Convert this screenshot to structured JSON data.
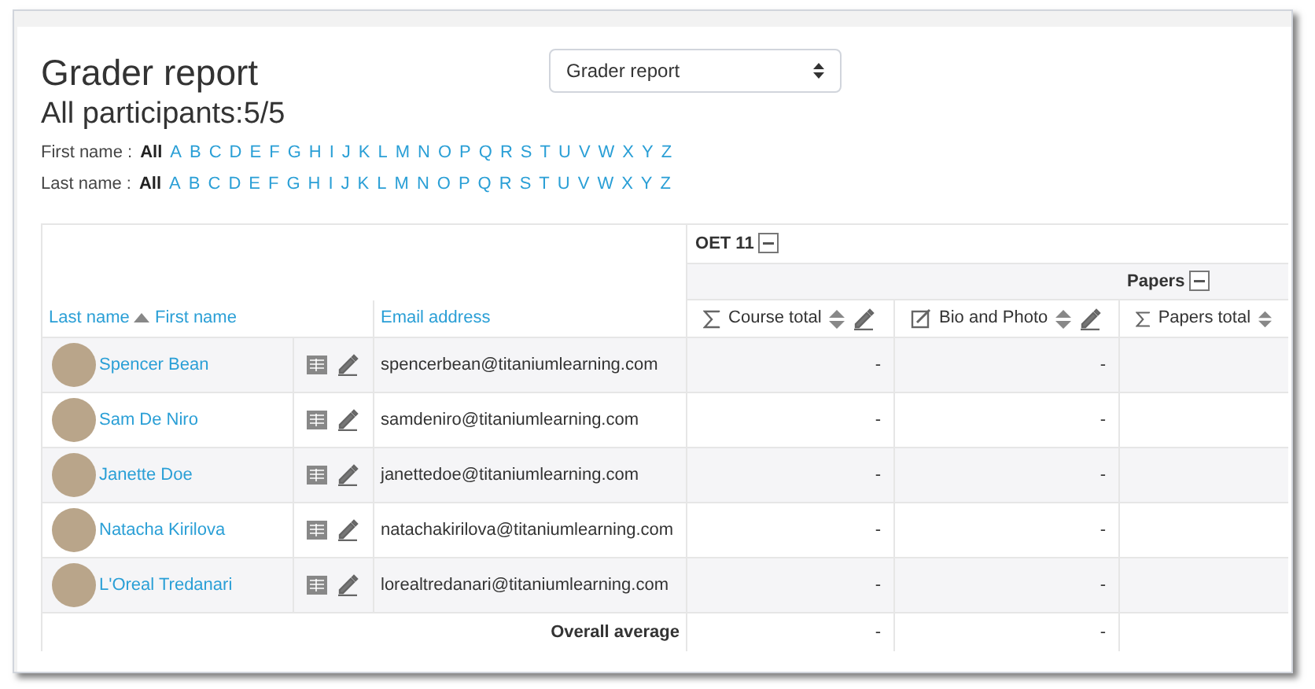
{
  "title": "Grader report",
  "subtitle": "All participants:5/5",
  "report_select": {
    "value": "Grader report"
  },
  "filters": [
    {
      "label": "First name :",
      "options": [
        {
          "text": "All",
          "selected": true
        },
        {
          "text": "A",
          "selected": false
        },
        {
          "text": "B",
          "selected": false
        },
        {
          "text": "C",
          "selected": false
        },
        {
          "text": "D",
          "selected": false
        },
        {
          "text": "E",
          "selected": false
        },
        {
          "text": "F",
          "selected": false
        },
        {
          "text": "G",
          "selected": false
        },
        {
          "text": "H",
          "selected": false
        },
        {
          "text": "I",
          "selected": false
        },
        {
          "text": "J",
          "selected": false
        },
        {
          "text": "K",
          "selected": false
        },
        {
          "text": "L",
          "selected": false
        },
        {
          "text": "M",
          "selected": false
        },
        {
          "text": "N",
          "selected": false
        },
        {
          "text": "O",
          "selected": false
        },
        {
          "text": "P",
          "selected": false
        },
        {
          "text": "Q",
          "selected": false
        },
        {
          "text": "R",
          "selected": false
        },
        {
          "text": "S",
          "selected": false
        },
        {
          "text": "T",
          "selected": false
        },
        {
          "text": "U",
          "selected": false
        },
        {
          "text": "V",
          "selected": false
        },
        {
          "text": "W",
          "selected": false
        },
        {
          "text": "X",
          "selected": false
        },
        {
          "text": "Y",
          "selected": false
        },
        {
          "text": "Z",
          "selected": false
        }
      ]
    },
    {
      "label": "Last name :",
      "options": [
        {
          "text": "All",
          "selected": true
        },
        {
          "text": "A",
          "selected": false
        },
        {
          "text": "B",
          "selected": false
        },
        {
          "text": "C",
          "selected": false
        },
        {
          "text": "D",
          "selected": false
        },
        {
          "text": "E",
          "selected": false
        },
        {
          "text": "F",
          "selected": false
        },
        {
          "text": "G",
          "selected": false
        },
        {
          "text": "H",
          "selected": false
        },
        {
          "text": "I",
          "selected": false
        },
        {
          "text": "J",
          "selected": false
        },
        {
          "text": "K",
          "selected": false
        },
        {
          "text": "L",
          "selected": false
        },
        {
          "text": "M",
          "selected": false
        },
        {
          "text": "N",
          "selected": false
        },
        {
          "text": "O",
          "selected": false
        },
        {
          "text": "P",
          "selected": false
        },
        {
          "text": "Q",
          "selected": false
        },
        {
          "text": "R",
          "selected": false
        },
        {
          "text": "S",
          "selected": false
        },
        {
          "text": "T",
          "selected": false
        },
        {
          "text": "U",
          "selected": false
        },
        {
          "text": "V",
          "selected": false
        },
        {
          "text": "W",
          "selected": false
        },
        {
          "text": "X",
          "selected": false
        },
        {
          "text": "Y",
          "selected": false
        },
        {
          "text": "Z",
          "selected": false
        }
      ]
    }
  ],
  "table": {
    "category": "OET 11",
    "subcategory": "Papers",
    "name_sort": [
      {
        "label": "Last name",
        "sorted": true
      },
      {
        "label": "First name",
        "sorted": false
      }
    ],
    "email_header": "Email address",
    "grade_columns": [
      {
        "label": "Course total",
        "kind": "total",
        "editable": true
      },
      {
        "label": "Bio and Photo",
        "kind": "assignment",
        "editable": true
      },
      {
        "label": "Papers total",
        "kind": "total",
        "editable": false
      }
    ],
    "rows": [
      {
        "name": "Spencer Bean",
        "email": "spencerbean@titaniumlearning.com",
        "grades": [
          "-",
          "-"
        ]
      },
      {
        "name": "Sam De Niro",
        "email": "samdeniro@titaniumlearning.com",
        "grades": [
          "-",
          "-"
        ]
      },
      {
        "name": "Janette Doe",
        "email": "janettedoe@titaniumlearning.com",
        "grades": [
          "-",
          "-"
        ]
      },
      {
        "name": "Natacha Kirilova",
        "email": "natachakirilova@titaniumlearning.com",
        "grades": [
          "-",
          "-"
        ]
      },
      {
        "name": "L'Oreal Tredanari",
        "email": "lorealtredanari@titaniumlearning.com",
        "grades": [
          "-",
          "-"
        ]
      }
    ],
    "average": {
      "label": "Overall average",
      "grades": [
        "-",
        "-"
      ]
    }
  }
}
